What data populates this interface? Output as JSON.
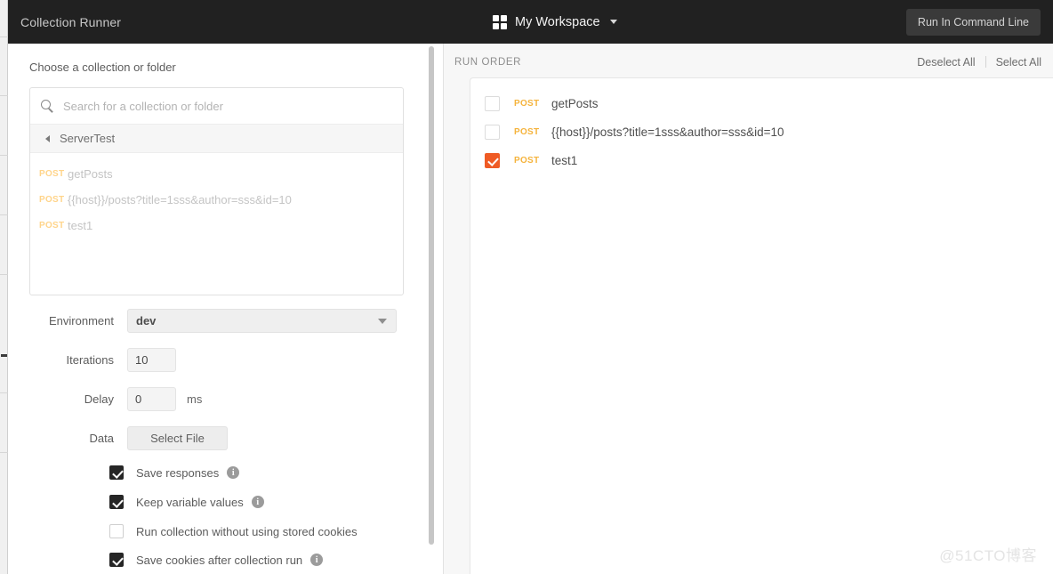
{
  "window": {
    "title": "Collection Runner"
  },
  "topbar": {
    "workspace_icon": "grid-icon",
    "workspace_name": "My Workspace",
    "workspace_caret": "chevron-down-icon",
    "command_line_button": "Run In Command Line"
  },
  "left_panel": {
    "section_label": "Choose a collection or folder",
    "search": {
      "icon": "search-icon",
      "placeholder": "Search for a collection or folder",
      "value": ""
    },
    "breadcrumb": {
      "back_icon": "chevron-left-icon",
      "label": "ServerTest"
    },
    "requests": [
      {
        "method": "POST",
        "name": "getPosts"
      },
      {
        "method": "POST",
        "name": "{{host}}/posts?title=1sss&author=sss&id=10"
      },
      {
        "method": "POST",
        "name": "test1"
      }
    ],
    "form": {
      "environment_label": "Environment",
      "environment_value": "dev",
      "iterations_label": "Iterations",
      "iterations_value": "10",
      "delay_label": "Delay",
      "delay_value": "0",
      "delay_unit": "ms",
      "data_label": "Data",
      "data_button": "Select File"
    },
    "options": [
      {
        "label": "Save responses",
        "checked": true,
        "info": true
      },
      {
        "label": "Keep variable values",
        "checked": true,
        "info": true
      },
      {
        "label": "Run collection without using stored cookies",
        "checked": false,
        "info": false
      },
      {
        "label": "Save cookies after collection run",
        "checked": true,
        "info": true
      }
    ]
  },
  "right_panel": {
    "heading": "RUN ORDER",
    "deselect_all": "Deselect All",
    "select_all": "Select All",
    "items": [
      {
        "method": "POST",
        "name": "getPosts",
        "checked": false
      },
      {
        "method": "POST",
        "name": "{{host}}/posts?title=1sss&author=sss&id=10",
        "checked": false
      },
      {
        "method": "POST",
        "name": "test1",
        "checked": true
      }
    ]
  },
  "watermark": "@51CTO博客",
  "colors": {
    "topbar_bg": "#212121",
    "accent_orange": "#EF5B25",
    "method_post": "#F5B33C",
    "right_panel_bg": "#F7F7F7"
  }
}
